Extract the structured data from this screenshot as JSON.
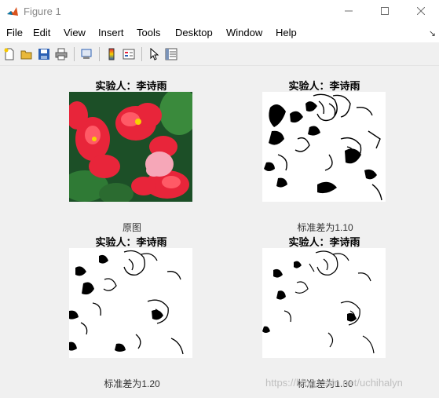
{
  "window": {
    "title": "Figure 1"
  },
  "menu": [
    "File",
    "Edit",
    "View",
    "Insert",
    "Tools",
    "Desktop",
    "Window",
    "Help"
  ],
  "toolbar": {
    "buttons": [
      "new-figure-icon",
      "open-file-icon",
      "save-icon",
      "print-icon",
      "print-preview-icon",
      "colorbar-icon",
      "legend-icon",
      "pointer-icon",
      "property-inspector-icon"
    ]
  },
  "subplots": [
    {
      "title": "实验人：李诗雨",
      "xlabel": "原图"
    },
    {
      "title": "实验人：李诗雨",
      "xlabel": "标准差为1.10"
    },
    {
      "title": "实验人：李诗雨",
      "xlabel": "标准差为1.20"
    },
    {
      "title": "实验人：李诗雨",
      "xlabel": "标准差为1.30"
    }
  ],
  "watermark": "https://blog.csdn.net/uchihalyn",
  "colors": {
    "flower_red": "#e8253a",
    "leaf_green": "#1f5a2b",
    "pink": "#f6a7b8",
    "edge_black": "#000000"
  }
}
